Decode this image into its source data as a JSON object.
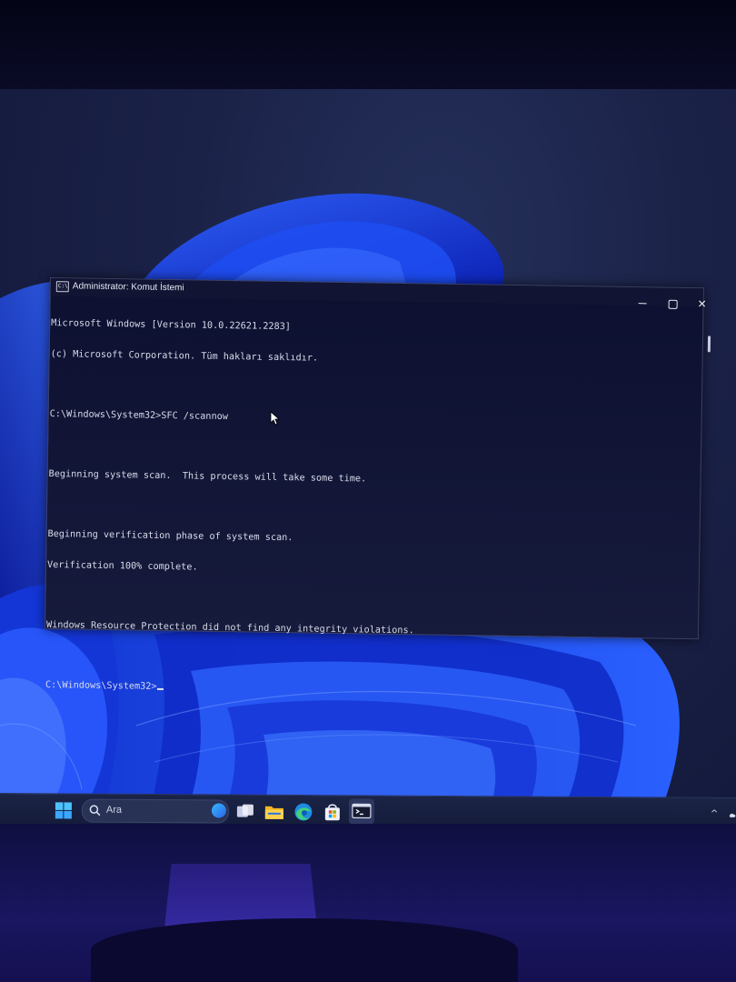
{
  "window": {
    "title": "Administrator: Komut İstemi",
    "icon_glyph": "C:\\",
    "controls": {
      "minimize": "minimize-icon",
      "maximize": "maximize-icon",
      "close": "✕"
    }
  },
  "console": {
    "lines": [
      "Microsoft Windows [Version 10.0.22621.2283]",
      "(c) Microsoft Corporation. Tüm hakları saklıdır.",
      "",
      "C:\\Windows\\System32>SFC /scannow",
      "",
      "Beginning system scan.  This process will take some time.",
      "",
      "Beginning verification phase of system scan.",
      "Verification 100% complete.",
      "",
      "Windows Resource Protection did not find any integrity violations.",
      "",
      "C:\\Windows\\System32>"
    ]
  },
  "taskbar": {
    "search_placeholder": "Ara",
    "icons": [
      "start-icon",
      "search-icon",
      "bing-icon",
      "task-view-icon",
      "file-explorer-icon",
      "edge-icon",
      "store-icon",
      "terminal-icon"
    ],
    "tray_chevron": "^"
  },
  "colors": {
    "console_bg": "#0d1030",
    "console_text": "#d8dbe9",
    "taskbar_bg": "#1b2446",
    "wallpaper_accent": "#1f4dff"
  }
}
